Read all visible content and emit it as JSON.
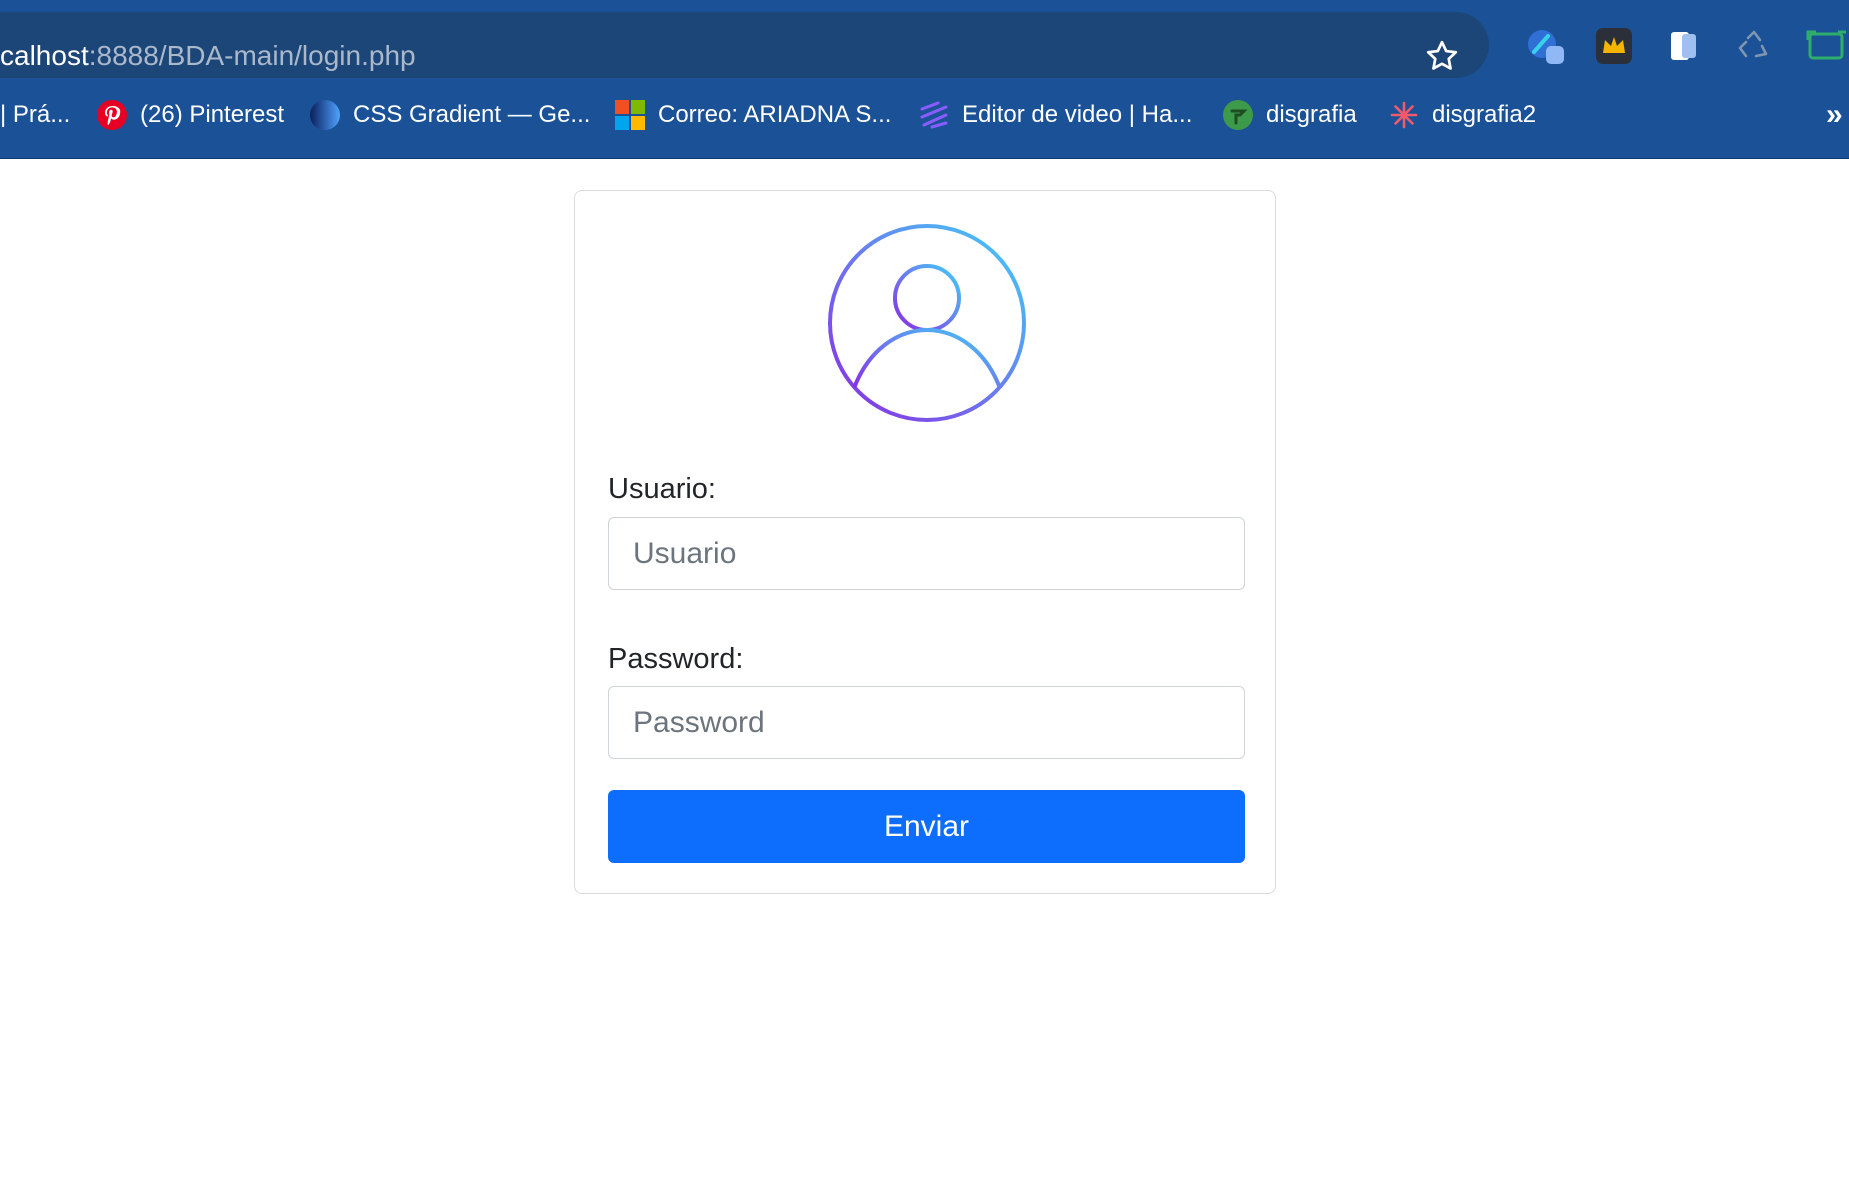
{
  "browser": {
    "url_host": "calhost",
    "url_path": ":8888/BDA-main/login.php",
    "bookmarks": [
      {
        "label": "| Prá...",
        "icon": "truncated-bookmark"
      },
      {
        "label": "(26) Pinterest",
        "icon": "pinterest-icon"
      },
      {
        "label": "CSS Gradient — Ge...",
        "icon": "css-gradient-icon"
      },
      {
        "label": "Correo: ARIADNA S...",
        "icon": "microsoft-icon"
      },
      {
        "label": "Editor de video | Ha...",
        "icon": "video-editor-icon"
      },
      {
        "label": "disgrafia",
        "icon": "disgrafia-icon"
      },
      {
        "label": "disgrafia2",
        "icon": "asterisk-icon"
      }
    ],
    "more_bookmarks": "»"
  },
  "login": {
    "user_label": "Usuario:",
    "user_placeholder": "Usuario",
    "password_label": "Password:",
    "password_placeholder": "Password",
    "submit_label": "Enviar"
  },
  "colors": {
    "chrome_bg": "#1b5297",
    "button_primary": "#0d6efd",
    "avatar_gradient_start": "#7b3ff2",
    "avatar_gradient_end": "#3fc6f2"
  }
}
